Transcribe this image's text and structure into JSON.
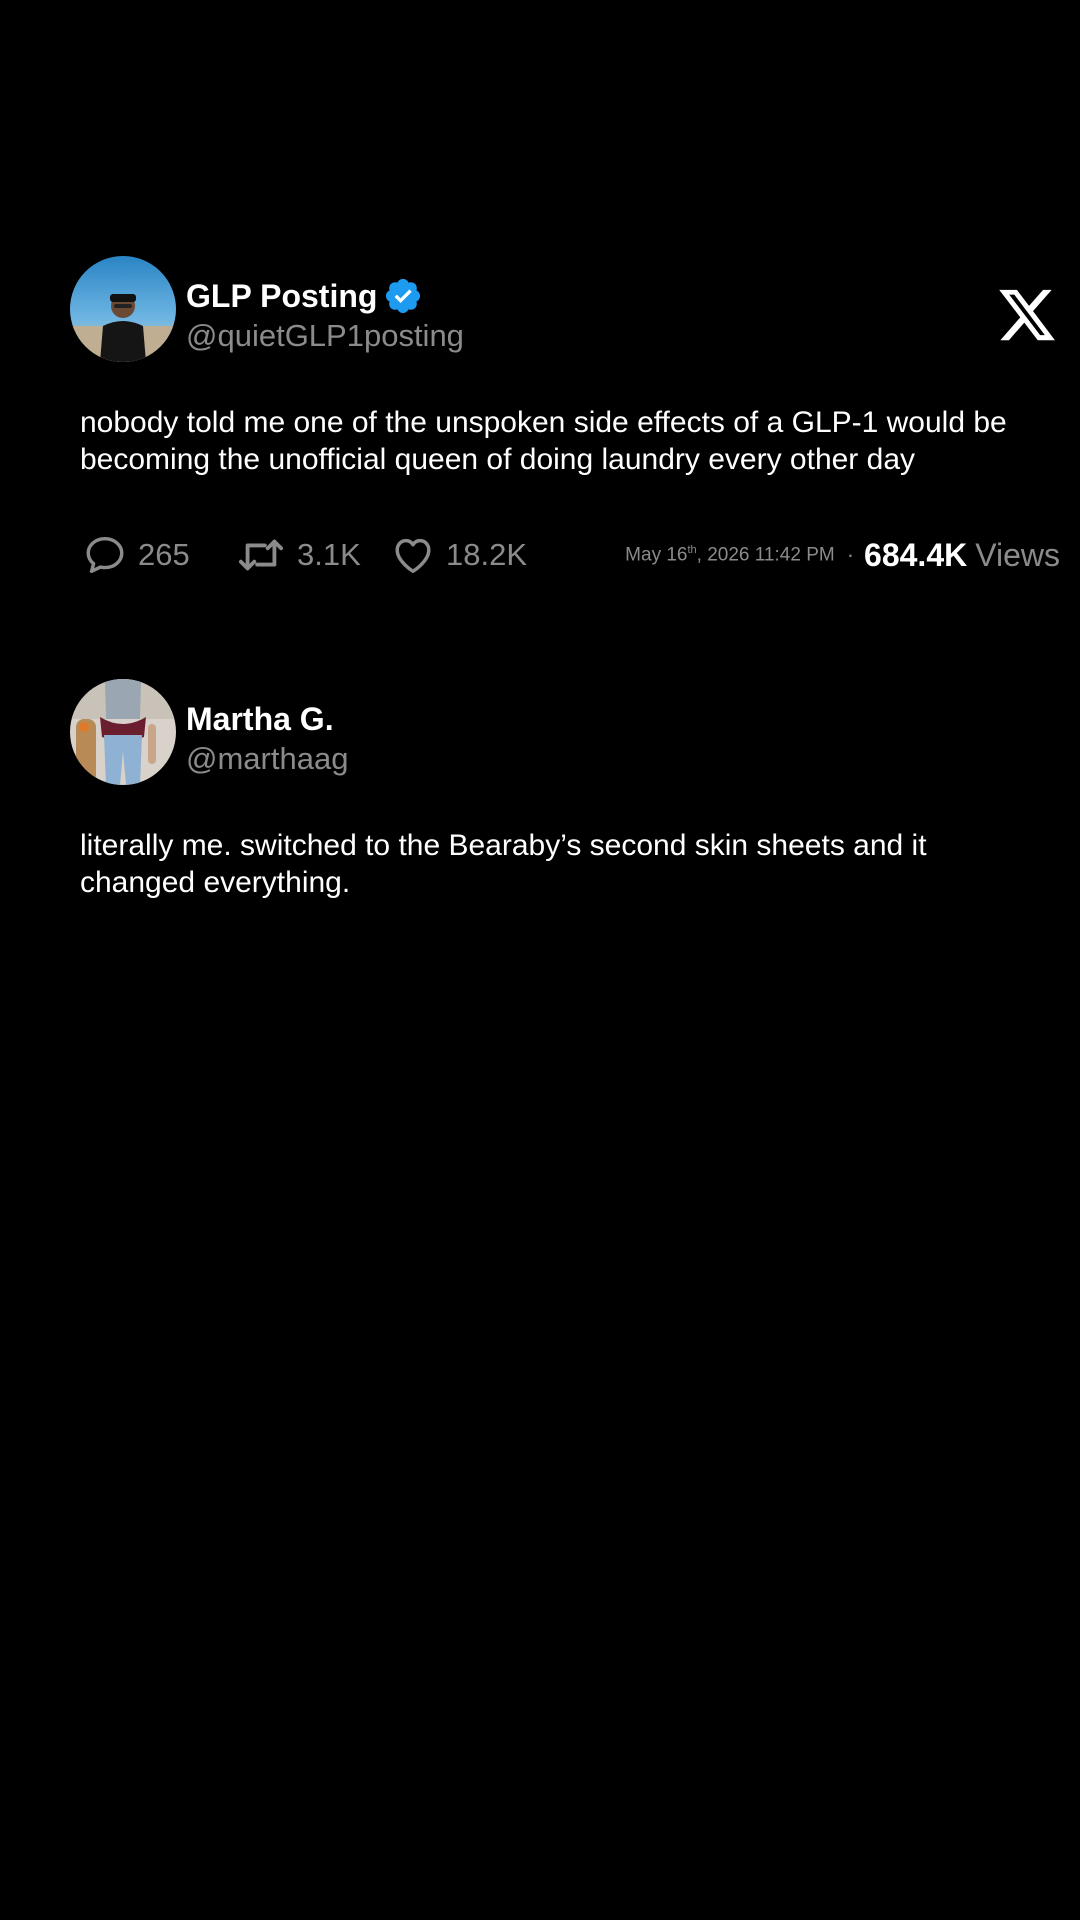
{
  "post": {
    "author": {
      "display_name": "GLP Posting",
      "handle": "@quietGLP1posting",
      "verified": true
    },
    "platform_icon": "x-logo-icon",
    "text": "nobody told me one of the unspoken side effects of a GLP-1 would be becoming the unofficial queen of doing laundry every other day",
    "stats": {
      "replies": "265",
      "retweets": "3.1K",
      "likes": "18.2K"
    },
    "timestamp": {
      "month_day": "May 16",
      "day_suffix": "th",
      "rest": ", 2026 11:42 PM"
    },
    "separator": "·",
    "views": {
      "count": "684.4K",
      "label": "Views"
    }
  },
  "reply": {
    "author": {
      "display_name": "Martha G.",
      "handle": "@marthaag"
    },
    "text": "literally me. switched to the Bearaby’s second skin sheets and it changed everything."
  },
  "colors": {
    "background": "#000000",
    "primary_text": "#ffffff",
    "secondary_text": "#8b8b8b",
    "verified_blue": "#1d9bf0"
  },
  "icons": [
    "verified-badge-icon",
    "x-logo-icon",
    "reply-icon",
    "retweet-icon",
    "like-icon"
  ]
}
